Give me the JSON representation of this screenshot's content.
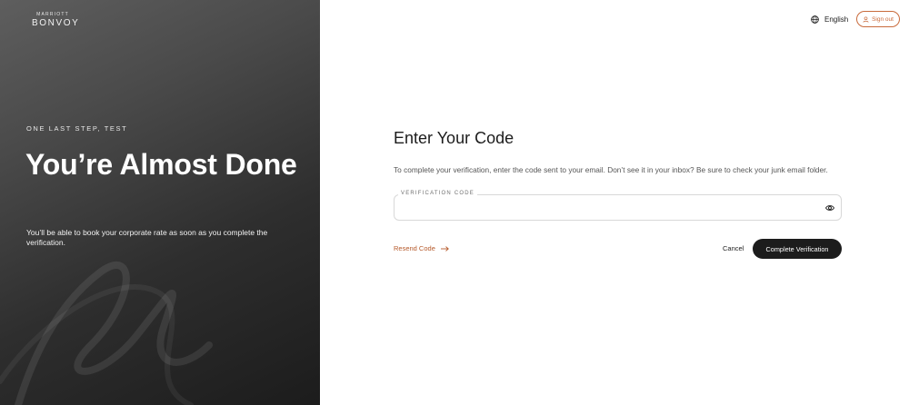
{
  "brand": {
    "logo_top": "MARRIOTT",
    "logo_bottom": "BONVOY"
  },
  "hero": {
    "eyebrow": "ONE LAST STEP, TEST",
    "title": "You’re Almost Done",
    "subtitle": "You’ll be able to book your corporate rate as soon as you complete the verification."
  },
  "header": {
    "language_label": "English",
    "language_icon": "globe-icon",
    "signout_label": "Sign out",
    "signout_icon": "user-icon"
  },
  "form": {
    "title": "Enter Your Code",
    "description": "To complete your verification, enter the code sent to your email. Don’t see it in your inbox? Be sure to check your junk email folder.",
    "field_label": "VERIFICATION CODE",
    "field_value": "",
    "field_icon": "eye-icon",
    "resend_label": "Resend Code",
    "cancel_label": "Cancel",
    "submit_label": "Complete Verification"
  },
  "colors": {
    "accent": "#c96b3c",
    "dark": "#1c1c1c",
    "panel_dark": "#1c1c1c",
    "panel_light": "#5e5e5e"
  }
}
